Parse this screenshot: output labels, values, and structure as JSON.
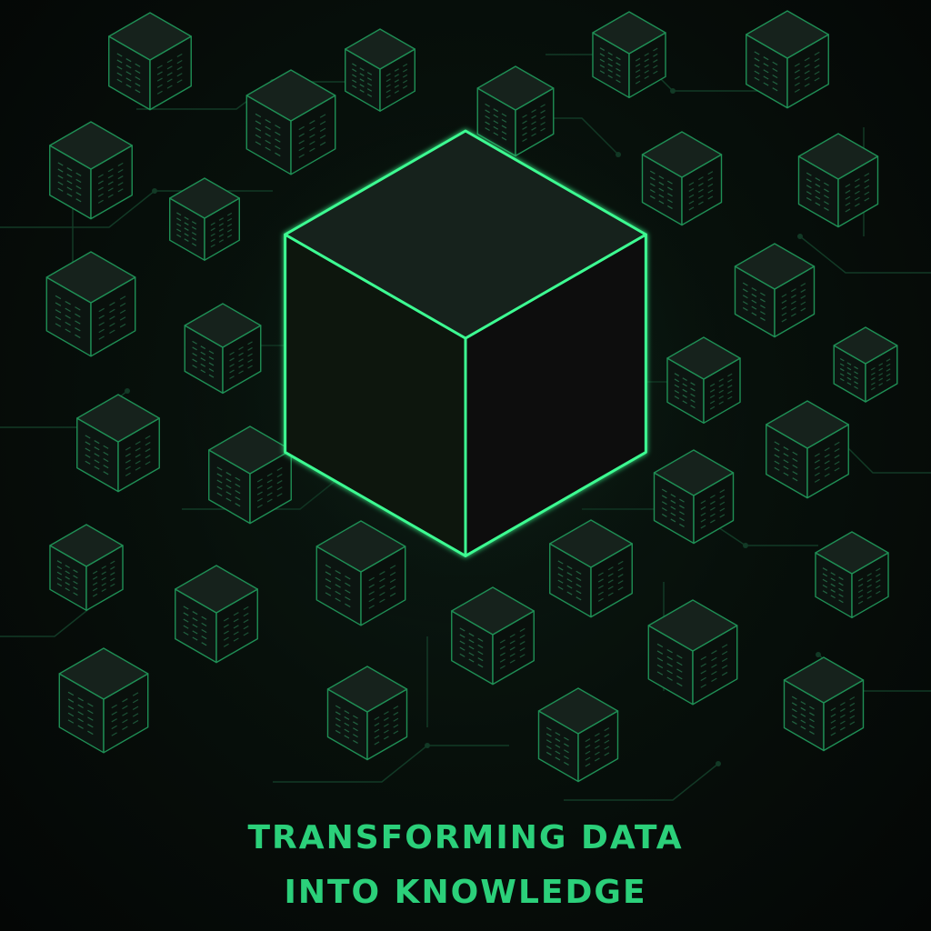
{
  "poster": {
    "headline_line1": "TRANSFORMING DATA",
    "headline_line2": "INTO KNOWLEDGE"
  },
  "colors": {
    "accent": "#2bd07a",
    "edge": "#1f8f55",
    "edge_bright": "#3dfc92",
    "face_top": "#16221c",
    "face_left": "#0c1511",
    "face_right": "#09100c",
    "background": "#050807",
    "circuit": "#123a26"
  },
  "icons": {
    "central": "large-glowing-cube",
    "nodes": "data-cube"
  }
}
